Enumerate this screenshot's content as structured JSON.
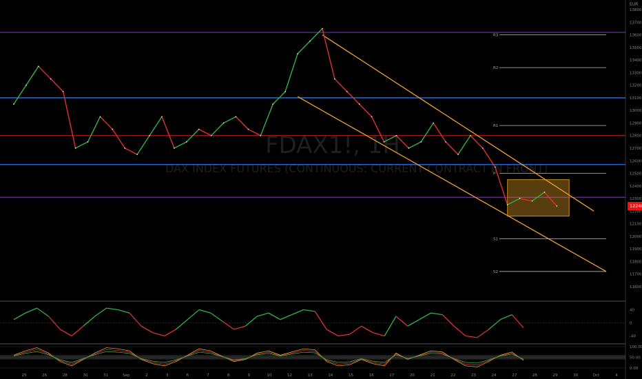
{
  "chart_data": {
    "type": "line",
    "watermark": {
      "symbol": "FDAX1!, 1H",
      "description": "DAX INDEX FUTURES (CONTINUOUS: CURRENT CONTRACT IN FRONT)"
    },
    "currency": "EUR",
    "last_price": 12240,
    "y_ticks": [
      11600,
      11700,
      11800,
      11900,
      12000,
      12100,
      12200,
      12300,
      12400,
      12500,
      12600,
      12700,
      12800,
      12900,
      13000,
      13100,
      13200,
      13300,
      13400,
      13500,
      13600,
      13700,
      13800
    ],
    "x_ticks": [
      "25",
      "26",
      "28",
      "30",
      "31",
      "Sep",
      "2",
      "3",
      "6",
      "7",
      "8",
      "9",
      "10",
      "12",
      "13",
      "14",
      "15",
      "16",
      "17",
      "20",
      "21",
      "22",
      "23",
      "24",
      "27",
      "28",
      "29",
      "30",
      "Oct",
      "4"
    ],
    "price_series": [
      {
        "x": 0.0,
        "y": 13050
      },
      {
        "x": 1.0,
        "y": 13200
      },
      {
        "x": 2.0,
        "y": 13350
      },
      {
        "x": 3.0,
        "y": 13250
      },
      {
        "x": 4.0,
        "y": 13150
      },
      {
        "x": 5.0,
        "y": 12700
      },
      {
        "x": 6.0,
        "y": 12750
      },
      {
        "x": 7.0,
        "y": 12950
      },
      {
        "x": 8.0,
        "y": 12850
      },
      {
        "x": 9.0,
        "y": 12700
      },
      {
        "x": 10.0,
        "y": 12650
      },
      {
        "x": 11.0,
        "y": 12800
      },
      {
        "x": 12.0,
        "y": 12950
      },
      {
        "x": 13.0,
        "y": 12700
      },
      {
        "x": 14.0,
        "y": 12750
      },
      {
        "x": 15.0,
        "y": 12850
      },
      {
        "x": 16.0,
        "y": 12800
      },
      {
        "x": 17.0,
        "y": 12900
      },
      {
        "x": 18.0,
        "y": 12950
      },
      {
        "x": 19.0,
        "y": 12850
      },
      {
        "x": 20.0,
        "y": 12800
      },
      {
        "x": 21.0,
        "y": 13050
      },
      {
        "x": 22.0,
        "y": 13150
      },
      {
        "x": 23.0,
        "y": 13450
      },
      {
        "x": 24.0,
        "y": 13550
      },
      {
        "x": 25.0,
        "y": 13650
      },
      {
        "x": 26.0,
        "y": 13250
      },
      {
        "x": 27.0,
        "y": 13150
      },
      {
        "x": 28.0,
        "y": 13050
      },
      {
        "x": 29.0,
        "y": 12950
      },
      {
        "x": 30.0,
        "y": 12750
      },
      {
        "x": 31.0,
        "y": 12800
      },
      {
        "x": 32.0,
        "y": 12700
      },
      {
        "x": 33.0,
        "y": 12750
      },
      {
        "x": 34.0,
        "y": 12900
      },
      {
        "x": 35.0,
        "y": 12750
      },
      {
        "x": 36.0,
        "y": 12650
      },
      {
        "x": 37.0,
        "y": 12800
      },
      {
        "x": 38.0,
        "y": 12700
      },
      {
        "x": 39.0,
        "y": 12550
      },
      {
        "x": 40.0,
        "y": 12250
      },
      {
        "x": 41.0,
        "y": 12300
      },
      {
        "x": 42.0,
        "y": 12280
      },
      {
        "x": 43.0,
        "y": 12350
      },
      {
        "x": 44.0,
        "y": 12240
      }
    ],
    "levels": [
      {
        "label": "R3",
        "value": 13600
      },
      {
        "label": "R2",
        "value": 13340
      },
      {
        "label": "R1",
        "value": 12880
      },
      {
        "label": "P",
        "value": 12500
      },
      {
        "label": "S1",
        "value": 11980
      },
      {
        "label": "S2",
        "value": 11720
      }
    ],
    "horizontal_lines": [
      {
        "value": 13100,
        "color": "#1e5fd6"
      },
      {
        "value": 12570,
        "color": "#1e5fd6"
      },
      {
        "value": 12800,
        "color": "#d11a1a"
      },
      {
        "value": 13620,
        "color": "#7a3fb0"
      },
      {
        "value": 12310,
        "color": "#7a3fb0"
      }
    ],
    "channel": {
      "color": "#f0a030",
      "upper": [
        [
          25,
          13600
        ],
        [
          47,
          12200
        ]
      ],
      "lower": [
        [
          23,
          13110
        ],
        [
          48,
          11720
        ]
      ]
    },
    "consolidation_box": {
      "x0": 40.0,
      "x1": 45.0,
      "y0": 12160,
      "y1": 12450,
      "color": "#c48a1e"
    },
    "momentum": {
      "y_ticks": [
        40,
        0,
        -40
      ],
      "values": [
        10,
        30,
        45,
        20,
        -20,
        -40,
        -10,
        20,
        45,
        40,
        30,
        -10,
        -30,
        -40,
        -20,
        10,
        40,
        30,
        5,
        -20,
        -10,
        20,
        30,
        10,
        25,
        40,
        35,
        -20,
        -40,
        -35,
        -10,
        -30,
        -40,
        20,
        -10,
        10,
        30,
        25,
        -10,
        -40,
        -45,
        -20,
        10,
        25,
        -15
      ]
    },
    "oscillator": {
      "y_ticks": [
        100,
        50,
        0
      ],
      "band": [
        40,
        60
      ]
    }
  }
}
